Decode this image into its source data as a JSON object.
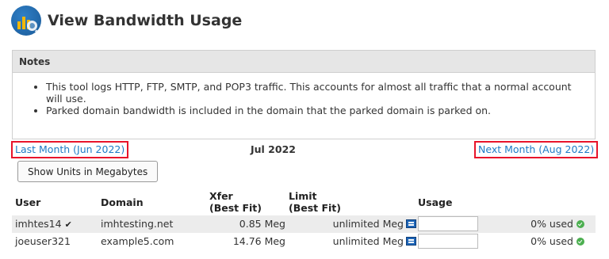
{
  "page": {
    "title": "View Bandwidth Usage",
    "icon": "bandwidth-chart-magnifier-icon"
  },
  "notes": {
    "heading": "Notes",
    "items": [
      "This tool logs HTTP, FTP, SMTP, and POP3 traffic. This accounts for almost all traffic that a normal account will use.",
      "Parked domain bandwidth is included in the domain that the parked domain is parked on."
    ]
  },
  "navigation": {
    "previous_month": "Last Month (Jun 2022)",
    "current_month": "Jul 2022",
    "next_month": "Next Month (Aug 2022)"
  },
  "units_button": "Show Units in Megabytes",
  "table": {
    "headers": {
      "user": "User",
      "domain": "Domain",
      "xfer": "Xfer\n(Best Fit)",
      "limit": "Limit\n(Best Fit)",
      "usage": "Usage"
    },
    "rows": [
      {
        "user": "imhtes14",
        "domain": "imhtesting.net",
        "xfer": "0.85 Meg",
        "limit": "unlimited Meg",
        "usage": "0% used",
        "usage_percent": 0,
        "verified": true
      },
      {
        "user": "joeuser321",
        "domain": "example5.com",
        "xfer": "14.76 Meg",
        "limit": "unlimited Meg",
        "usage": "0% used",
        "usage_percent": 0,
        "verified": false
      }
    ]
  },
  "colors": {
    "link": "#1e7bc6",
    "highlight_border": "#e8142b",
    "ok": "#4caf50"
  }
}
